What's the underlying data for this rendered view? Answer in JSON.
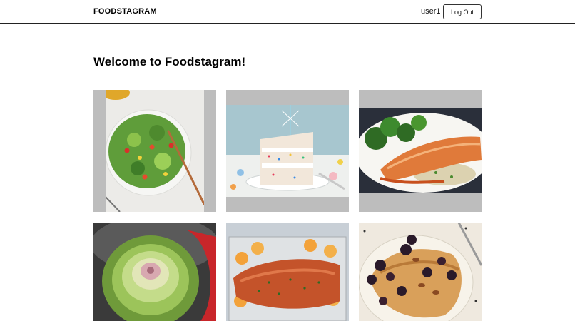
{
  "navbar": {
    "brand": "FOODSTAGRAM",
    "username": "user1",
    "logout_label": "Log Out"
  },
  "main": {
    "heading": "Welcome to Foodstagram!"
  },
  "posts": [
    {
      "icon": "salad-image"
    },
    {
      "icon": "birthday-cake-image"
    },
    {
      "icon": "salmon-plate-image"
    },
    {
      "icon": "artichoke-image"
    },
    {
      "icon": "baked-salmon-tray-image"
    },
    {
      "icon": "pecan-french-toast-image"
    }
  ]
}
